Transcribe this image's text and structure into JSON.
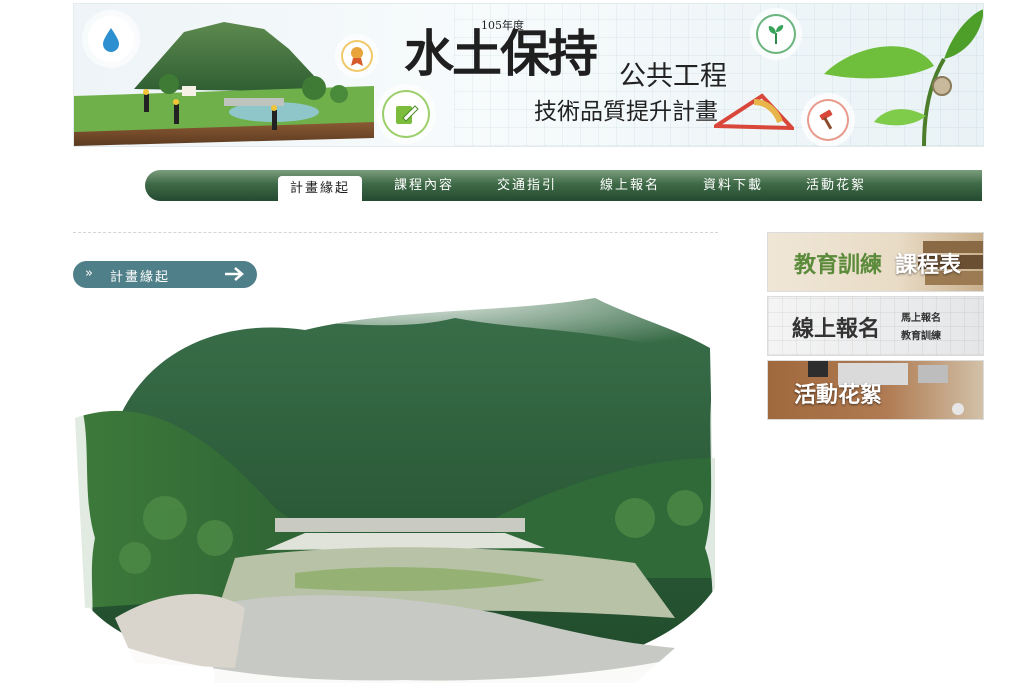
{
  "banner": {
    "year": "105年度",
    "title_main": "水土保持",
    "title_sub1": "公共工程",
    "title_sub2": "技術品質提升計畫"
  },
  "nav": {
    "items": [
      {
        "label": "計畫緣起",
        "active": true
      },
      {
        "label": "課程內容"
      },
      {
        "label": "交通指引"
      },
      {
        "label": "線上報名"
      },
      {
        "label": "資料下載"
      },
      {
        "label": "活動花絮"
      }
    ]
  },
  "breadcrumb": {
    "chevron": "»",
    "label": "計畫緣起"
  },
  "sidebar": {
    "btn1": {
      "text_a": "教育訓練",
      "text_b": "課程表"
    },
    "btn2": {
      "text_main": "線上報名",
      "text_small1": "馬上報名",
      "text_small2": "教育訓練"
    },
    "btn3": {
      "text": "活動花絮"
    }
  },
  "colors": {
    "nav_dark": "#244a30",
    "breadcrumb_bg": "#4f7f88",
    "sidebar_green": "#5a8a3a"
  },
  "icons": [
    "water-drop-icon",
    "award-icon",
    "sprout-icon",
    "edit-icon",
    "hammer-icon",
    "triangle-ruler-icon",
    "arrow-right-icon"
  ]
}
